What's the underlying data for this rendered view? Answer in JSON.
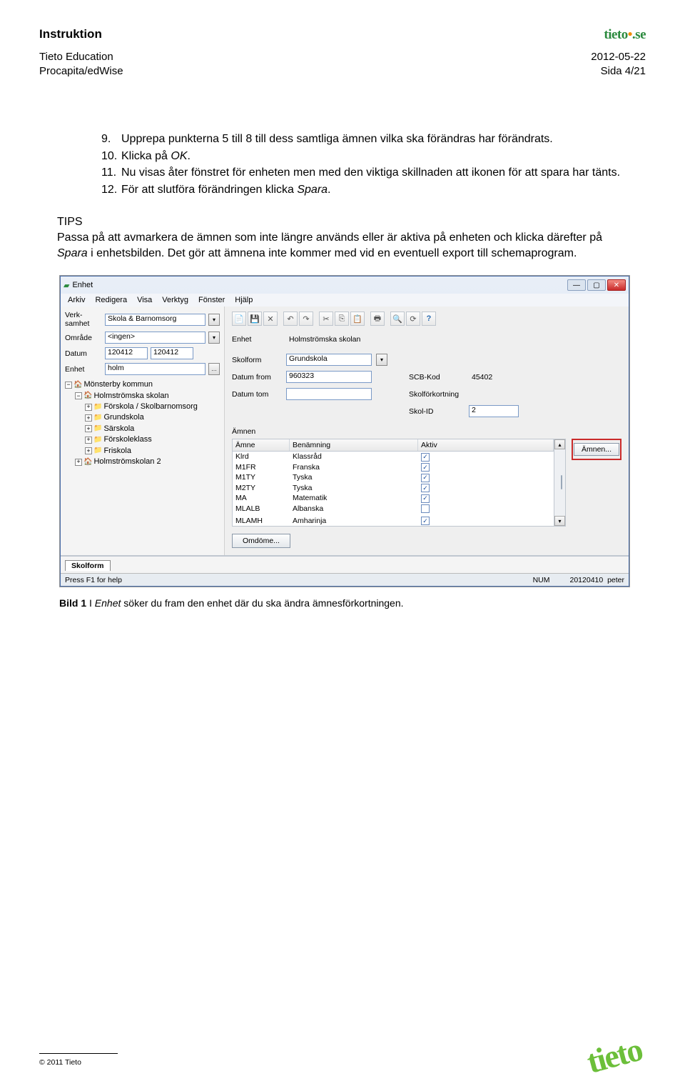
{
  "header": {
    "doc_title": "Instruktion",
    "org1": "Tieto Education",
    "org2": "Procapita/edWise",
    "date": "2012-05-22",
    "page": "Sida 4/21",
    "logo_brand": "tieto",
    "logo_tld": ".se"
  },
  "instructions": [
    {
      "num": "9.",
      "pre": "Upprepa punkterna 5 till 8 till dess samtliga ämnen vilka ska förändras har förändrats.",
      "ital": "",
      "post": ""
    },
    {
      "num": "10.",
      "pre": "Klicka på ",
      "ital": "OK",
      "post": "."
    },
    {
      "num": "11.",
      "pre": "Nu visas åter fönstret för enheten men med den viktiga skillnaden att ikonen för att spara har tänts.",
      "ital": "",
      "post": ""
    },
    {
      "num": "12.",
      "pre": "För att slutföra förändringen klicka ",
      "ital": "Spara",
      "post": "."
    }
  ],
  "tips": {
    "label": "TIPS",
    "p1_a": "Passa på att avmarkera de ämnen som inte längre används eller är aktiva på enheten och klicka därefter på ",
    "p1_i": "Spara",
    "p1_b": " i enhetsbilden. Det gör att ämnena inte kommer med vid en eventuell export till schemaprogram."
  },
  "window": {
    "title": "Enhet",
    "menu": [
      "Arkiv",
      "Redigera",
      "Visa",
      "Verktyg",
      "Fönster",
      "Hjälp"
    ],
    "left": {
      "verk_label": "Verk-\nsamhet",
      "verk_value": "Skola & Barnomsorg",
      "omrade_label": "Område",
      "omrade_value": "<ingen>",
      "datum_label": "Datum",
      "datum_from": "120412",
      "datum_to": "120412",
      "enhet_label": "Enhet",
      "enhet_value": "holm",
      "search_icon_name": "search-icon"
    },
    "tree": [
      {
        "level": 0,
        "exp": "-",
        "icon": "green",
        "text": "Mönsterby kommun"
      },
      {
        "level": 1,
        "exp": "-",
        "icon": "green",
        "text": "Holmströmska skolan"
      },
      {
        "level": 2,
        "exp": "+",
        "icon": "maroon",
        "text": "Förskola / Skolbarnomsorg"
      },
      {
        "level": 2,
        "exp": "+",
        "icon": "maroon",
        "text": "Grundskola"
      },
      {
        "level": 2,
        "exp": "+",
        "icon": "maroon",
        "text": "Särskola"
      },
      {
        "level": 2,
        "exp": "+",
        "icon": "maroon",
        "text": "Förskoleklass"
      },
      {
        "level": 2,
        "exp": "+",
        "icon": "maroon",
        "text": "Friskola"
      },
      {
        "level": 1,
        "exp": "+",
        "icon": "green",
        "text": "Holmströmskolan 2"
      }
    ],
    "right": {
      "enhet_label": "Enhet",
      "enhet_value": "Holmströmska skolan",
      "skolform_label": "Skolform",
      "skolform_value": "Grundskola",
      "datum_from_label": "Datum from",
      "datum_from_value": "960323",
      "scb_label": "SCB-Kod",
      "scb_value": "45402",
      "datum_tom_label": "Datum tom",
      "datum_tom_value": "",
      "skolfork_label": "Skolförkortning",
      "skolfork_value": "",
      "skolid_label": "Skol-ID",
      "skolid_value": "2",
      "amnen_header": "Ämnen",
      "col_amne": "Ämne",
      "col_benamning": "Benämning",
      "col_aktiv": "Aktiv",
      "amnen_button": "Ämnen...",
      "omdome_button": "Omdöme...",
      "subjects": [
        {
          "a": "Klrd",
          "b": "Klassråd",
          "chk": true
        },
        {
          "a": "M1FR",
          "b": "Franska",
          "chk": true
        },
        {
          "a": "M1TY",
          "b": "Tyska",
          "chk": true
        },
        {
          "a": "M2TY",
          "b": "Tyska",
          "chk": true
        },
        {
          "a": "MA",
          "b": "Matematik",
          "chk": true
        },
        {
          "a": "MLALB",
          "b": "Albanska",
          "chk": false
        },
        {
          "a": "MLAMH",
          "b": "Amharinja",
          "chk": true
        }
      ]
    },
    "tab_skolform": "Skolform",
    "status_left": "Press F1 for help",
    "status_num": "NUM",
    "status_date": "20120410",
    "status_user": "peter"
  },
  "caption": {
    "lead": "Bild 1",
    "rest_a": " I ",
    "ital": "Enhet",
    "rest_b": " söker du fram den enhet där du ska ändra ämnesförkortningen."
  },
  "footer": {
    "copyright": "© 2011 Tieto",
    "logo": "tieto"
  }
}
